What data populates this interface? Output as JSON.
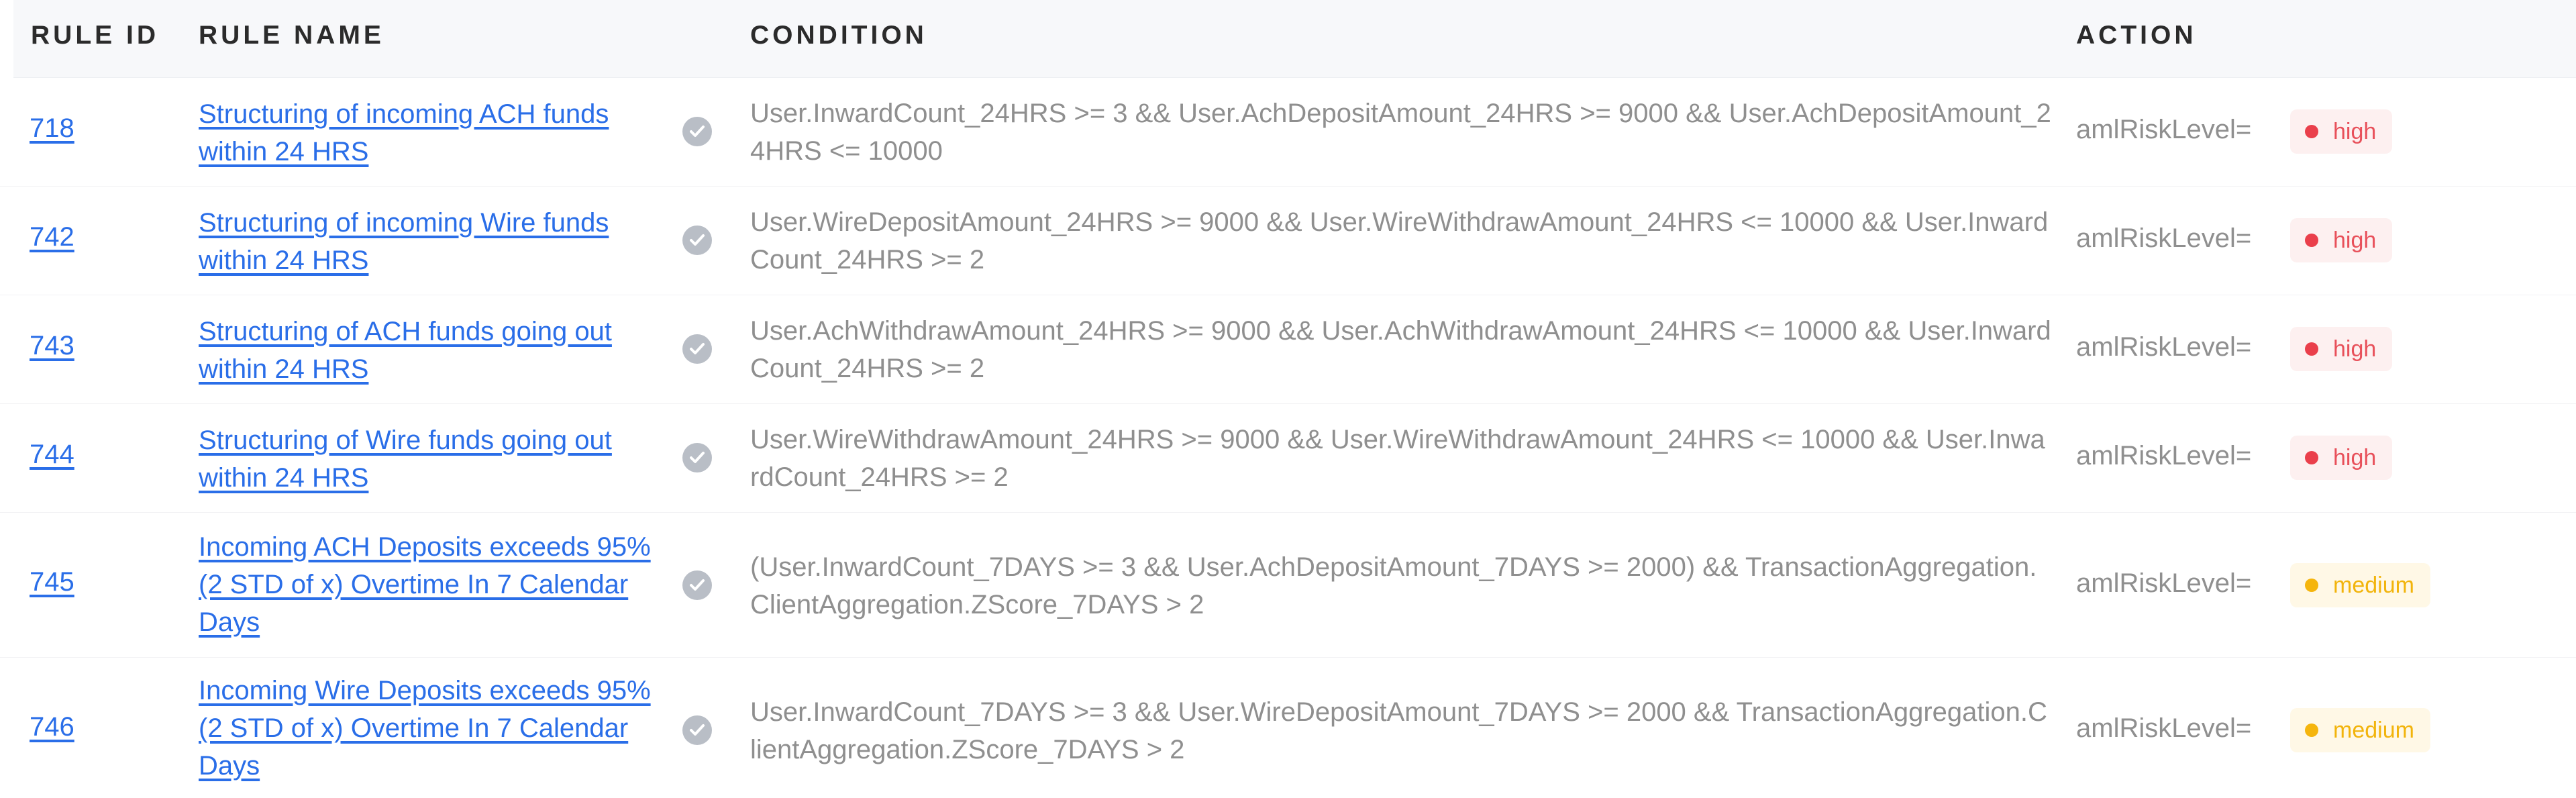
{
  "header": {
    "rule_id": "RULE ID",
    "rule_name": "RULE NAME",
    "condition": "CONDITION",
    "action": "ACTION"
  },
  "rows": [
    {
      "id": "718",
      "name": "Structuring of incoming ACH funds within 24 HRS",
      "condition": "User.InwardCount_24HRS >= 3 && User.AchDepositAmount_24HRS >= 9000 && User.AchDepositAmount_24HRS <= 10000",
      "action_label": "amlRiskLevel=",
      "level": "high",
      "check_icon": "check-circle-icon"
    },
    {
      "id": "742",
      "name": "Structuring of incoming Wire funds within 24 HRS",
      "condition": "User.WireDepositAmount_24HRS >= 9000 && User.WireWithdrawAmount_24HRS <= 10000 && User.InwardCount_24HRS >= 2",
      "action_label": "amlRiskLevel=",
      "level": "high",
      "check_icon": "check-circle-icon"
    },
    {
      "id": "743",
      "name": "Structuring of ACH funds going out within 24 HRS",
      "condition": "User.AchWithdrawAmount_24HRS >= 9000 && User.AchWithdrawAmount_24HRS <= 10000 && User.InwardCount_24HRS >= 2",
      "action_label": "amlRiskLevel=",
      "level": "high",
      "check_icon": "check-circle-icon"
    },
    {
      "id": "744",
      "name": "Structuring of Wire funds going out within 24 HRS",
      "condition": "User.WireWithdrawAmount_24HRS >= 9000 && User.WireWithdrawAmount_24HRS <= 10000 && User.InwardCount_24HRS >= 2",
      "action_label": "amlRiskLevel=",
      "level": "high",
      "check_icon": "check-circle-icon"
    },
    {
      "id": "745",
      "name": "Incoming ACH Deposits exceeds 95%(2 STD of x) Overtime In 7 Calendar Days",
      "condition": "(User.InwardCount_7DAYS >= 3 && User.AchDepositAmount_7DAYS >= 2000) && TransactionAggregation.ClientAggregation.ZScore_7DAYS > 2",
      "action_label": "amlRiskLevel=",
      "level": "medium",
      "check_icon": "check-circle-icon"
    },
    {
      "id": "746",
      "name": "Incoming Wire Deposits exceeds 95%(2 STD of x) Overtime In 7 Calendar Days",
      "condition": "User.InwardCount_7DAYS >= 3 && User.WireDepositAmount_7DAYS >= 2000 && TransactionAggregation.ClientAggregation.ZScore_7DAYS > 2",
      "action_label": "amlRiskLevel=",
      "level": "medium",
      "check_icon": "check-circle-icon"
    }
  ],
  "colors": {
    "link": "#2a6ee8",
    "high": "#ea3f4b",
    "medium": "#f5b50d",
    "header_bg": "#f7f8fa"
  }
}
